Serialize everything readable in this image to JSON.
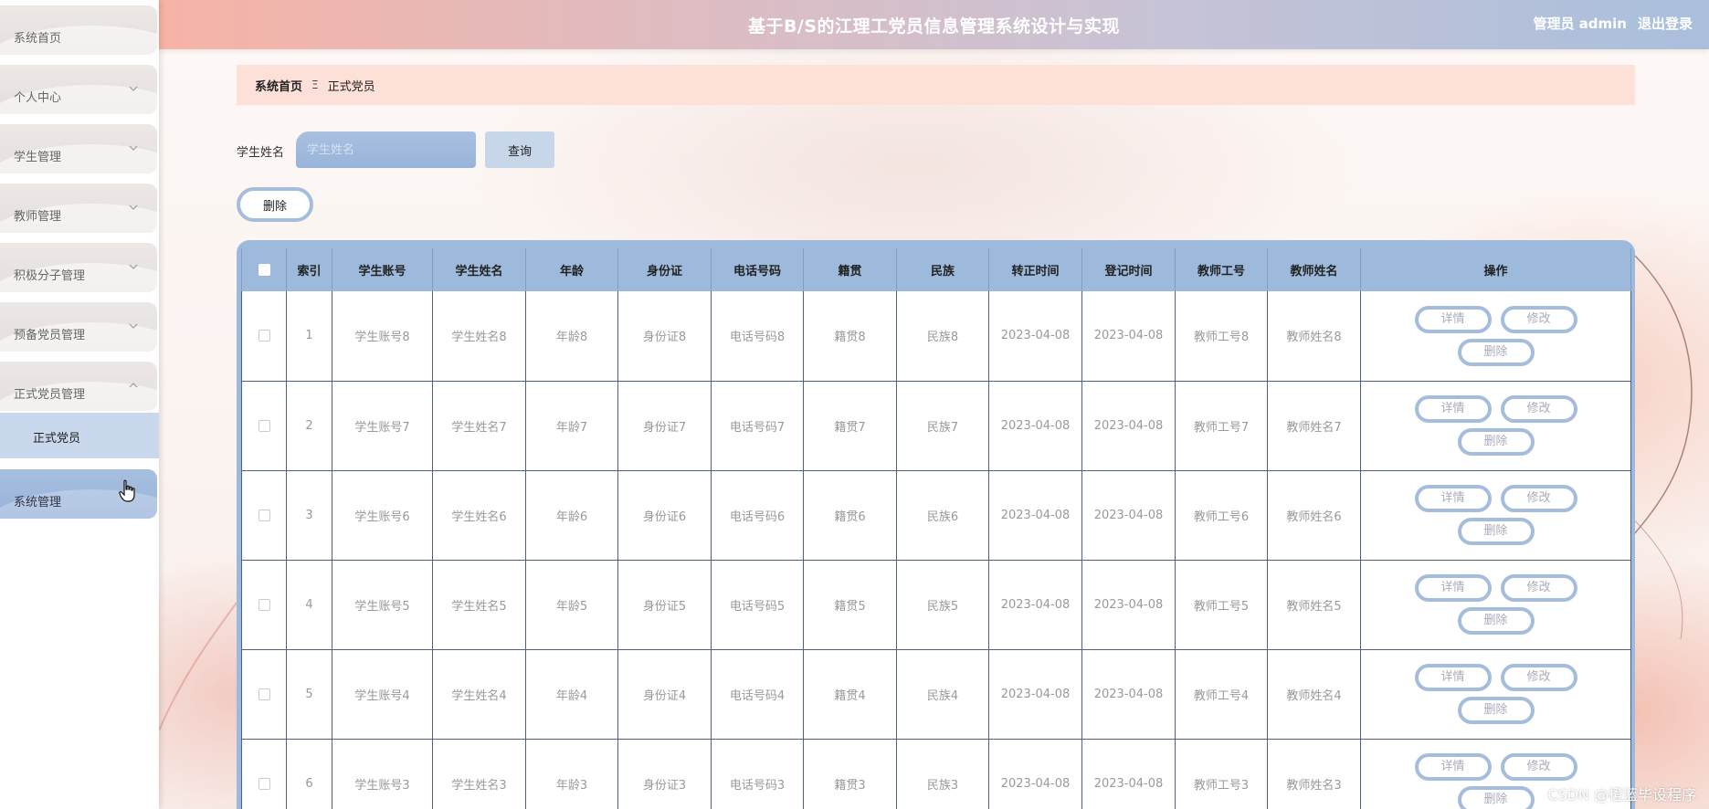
{
  "header": {
    "title": "基于B/S的江理工党员信息管理系统设计与实现",
    "user": "管理员 admin",
    "logout": "退出登录"
  },
  "sidebar": {
    "items": [
      {
        "label": "系统首页",
        "has_chevron": false
      },
      {
        "label": "个人中心",
        "has_chevron": true
      },
      {
        "label": "学生管理",
        "has_chevron": true
      },
      {
        "label": "教师管理",
        "has_chevron": true
      },
      {
        "label": "积极分子管理",
        "has_chevron": true
      },
      {
        "label": "预备党员管理",
        "has_chevron": true
      },
      {
        "label": "正式党员管理",
        "has_chevron": true,
        "expanded": true
      },
      {
        "label": "系统管理",
        "has_chevron": false,
        "active": true
      }
    ],
    "submenu": {
      "label": "正式党员"
    }
  },
  "breadcrumb": {
    "home": "系统首页",
    "separator": "Ξ",
    "current": "正式党员"
  },
  "search": {
    "label": "学生姓名",
    "placeholder": "学生姓名",
    "button": "查询"
  },
  "actions": {
    "delete": "删除"
  },
  "table": {
    "headers": [
      "索引",
      "学生账号",
      "学生姓名",
      "年龄",
      "身份证",
      "电话号码",
      "籍贯",
      "民族",
      "转正时间",
      "登记时间",
      "教师工号",
      "教师姓名",
      "操作"
    ],
    "rows": [
      {
        "index": "1",
        "account": "学生账号8",
        "name": "学生姓名8",
        "age": "年龄8",
        "id_card": "身份证8",
        "phone": "电话号码8",
        "hometown": "籍贯8",
        "ethnicity": "民族8",
        "regular_time": "2023-04-08",
        "register_time": "2023-04-08",
        "teacher_no": "教师工号8",
        "teacher_name": "教师姓名8"
      },
      {
        "index": "2",
        "account": "学生账号7",
        "name": "学生姓名7",
        "age": "年龄7",
        "id_card": "身份证7",
        "phone": "电话号码7",
        "hometown": "籍贯7",
        "ethnicity": "民族7",
        "regular_time": "2023-04-08",
        "register_time": "2023-04-08",
        "teacher_no": "教师工号7",
        "teacher_name": "教师姓名7"
      },
      {
        "index": "3",
        "account": "学生账号6",
        "name": "学生姓名6",
        "age": "年龄6",
        "id_card": "身份证6",
        "phone": "电话号码6",
        "hometown": "籍贯6",
        "ethnicity": "民族6",
        "regular_time": "2023-04-08",
        "register_time": "2023-04-08",
        "teacher_no": "教师工号6",
        "teacher_name": "教师姓名6"
      },
      {
        "index": "4",
        "account": "学生账号5",
        "name": "学生姓名5",
        "age": "年龄5",
        "id_card": "身份证5",
        "phone": "电话号码5",
        "hometown": "籍贯5",
        "ethnicity": "民族5",
        "regular_time": "2023-04-08",
        "register_time": "2023-04-08",
        "teacher_no": "教师工号5",
        "teacher_name": "教师姓名5"
      },
      {
        "index": "5",
        "account": "学生账号4",
        "name": "学生姓名4",
        "age": "年龄4",
        "id_card": "身份证4",
        "phone": "电话号码4",
        "hometown": "籍贯4",
        "ethnicity": "民族4",
        "regular_time": "2023-04-08",
        "register_time": "2023-04-08",
        "teacher_no": "教师工号4",
        "teacher_name": "教师姓名4"
      },
      {
        "index": "6",
        "account": "学生账号3",
        "name": "学生姓名3",
        "age": "年龄3",
        "id_card": "身份证3",
        "phone": "电话号码3",
        "hometown": "籍贯3",
        "ethnicity": "民族3",
        "regular_time": "2023-04-08",
        "register_time": "2023-04-08",
        "teacher_no": "教师工号3",
        "teacher_name": "教师姓名3"
      }
    ],
    "row_actions": {
      "detail": "详情",
      "edit": "修改",
      "delete": "删除"
    }
  },
  "watermark": "CSDN @橙蓝毕设程序",
  "colors": {
    "accent": "#9dbadd",
    "breadcrumb_bg": "#fde0d8",
    "header_start": "#f6b3a6",
    "header_end": "#a9bfdc"
  }
}
